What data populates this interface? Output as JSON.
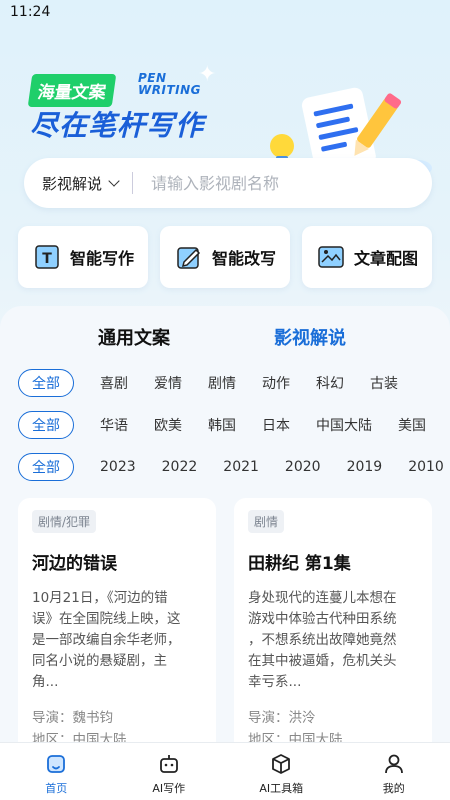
{
  "status_bar": {
    "time": "11:24"
  },
  "hero": {
    "badge": "海量文案",
    "pen_line1": "PEN",
    "pen_line2": "WRITING",
    "title": "尽在笔杆写作"
  },
  "search": {
    "category": "影视解说",
    "placeholder": "请输入影视剧名称"
  },
  "features": [
    {
      "label": "智能写作",
      "icon": "text-box-icon"
    },
    {
      "label": "智能改写",
      "icon": "edit-pen-icon"
    },
    {
      "label": "文章配图",
      "icon": "image-icon"
    }
  ],
  "tabs": {
    "general": "通用文案",
    "film": "影视解说"
  },
  "filters": {
    "all_label": "全部",
    "genres": [
      "喜剧",
      "爱情",
      "剧情",
      "动作",
      "科幻",
      "古装"
    ],
    "regions": [
      "华语",
      "欧美",
      "韩国",
      "日本",
      "中国大陆",
      "美国"
    ],
    "years": [
      "2023",
      "2022",
      "2021",
      "2020",
      "2019",
      "2010"
    ]
  },
  "cards": [
    {
      "tag": "剧情/犯罪",
      "title": "河边的错误",
      "desc_lines": [
        "10月21日，《河边的错",
        "误》在全国院线上映，这",
        "是一部改编自余华老师，",
        "同名小说的悬疑剧，主",
        "角..."
      ],
      "director": "导演：魏书钧",
      "region": "地区：中国大陆"
    },
    {
      "tag": "剧情",
      "title": "田耕纪 第1集",
      "desc_lines": [
        "身处现代的连蔓儿本想在",
        "游戏中体验古代种田系统",
        "，不想系统出故障她竟然",
        "在其中被逼婚，危机关头",
        "幸亏系..."
      ],
      "director": "导演：洪泠",
      "region": "地区：中国大陆"
    }
  ],
  "bottom_nav": [
    {
      "label": "首页",
      "icon": "home-icon",
      "active": true
    },
    {
      "label": "AI写作",
      "icon": "robot-icon",
      "active": false
    },
    {
      "label": "AI工具箱",
      "icon": "box-icon",
      "active": false
    },
    {
      "label": "我的",
      "icon": "user-icon",
      "active": false
    }
  ],
  "colors": {
    "accent": "#1a6ed8",
    "badge": "#1fcf6a"
  }
}
